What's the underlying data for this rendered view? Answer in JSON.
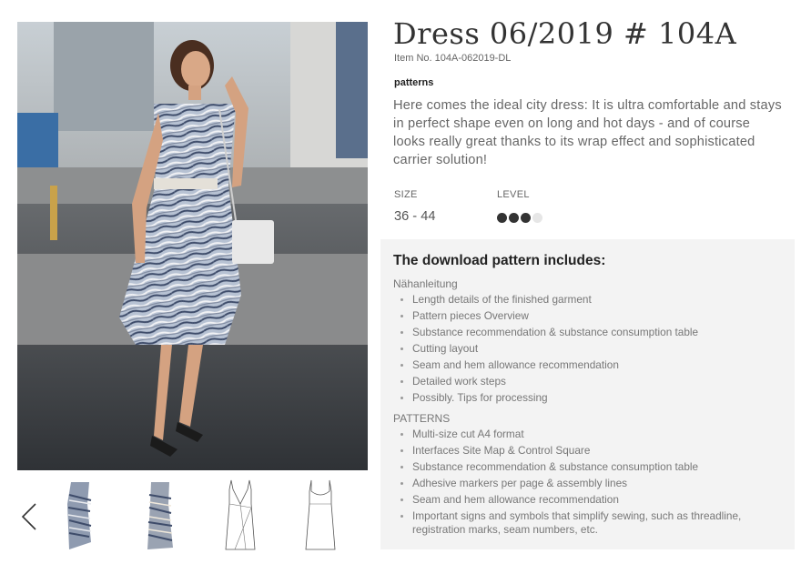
{
  "product": {
    "title": "Dress 06/2019 # 104A",
    "item_no": "Item No. 104A-062019-DL",
    "category": "patterns",
    "description": "Here comes the ideal city dress: It is ultra comfortable and stays in perfect shape even on long and hot days - and of course looks really great thanks to its wrap effect and sophisticated carrier solution!"
  },
  "specs": {
    "size_label": "SIZE",
    "size_value": "36 - 44",
    "level_label": "LEVEL",
    "level": 3,
    "level_max": 4
  },
  "includes": {
    "heading": "The download pattern includes:",
    "sections": [
      {
        "title": "Nähanleitung",
        "items": [
          "Length details of the finished garment",
          "Pattern pieces Overview",
          "Substance recommendation & substance consumption table",
          "Cutting layout",
          "Seam and hem allowance recommendation",
          "Detailed work steps",
          "Possibly. Tips for processing"
        ]
      },
      {
        "title": "PATTERNS",
        "items": [
          "Multi-size cut A4 format",
          "Interfaces Site Map & Control Square",
          "Substance recommendation & substance consumption table",
          "Adhesive markers per page & assembly lines",
          "Seam and hem allowance recommendation",
          "Important signs and symbols that simplify sewing, such as threadline, registration marks, seam numbers, etc."
        ]
      }
    ]
  },
  "gallery": {
    "thumbnails": [
      "photo-front",
      "photo-front-2",
      "sketch-wrap-front",
      "sketch-back"
    ]
  },
  "colors": {
    "dot_filled": "#333333",
    "dot_empty": "#e6e6e6",
    "panel_bg": "#f3f3f3"
  }
}
